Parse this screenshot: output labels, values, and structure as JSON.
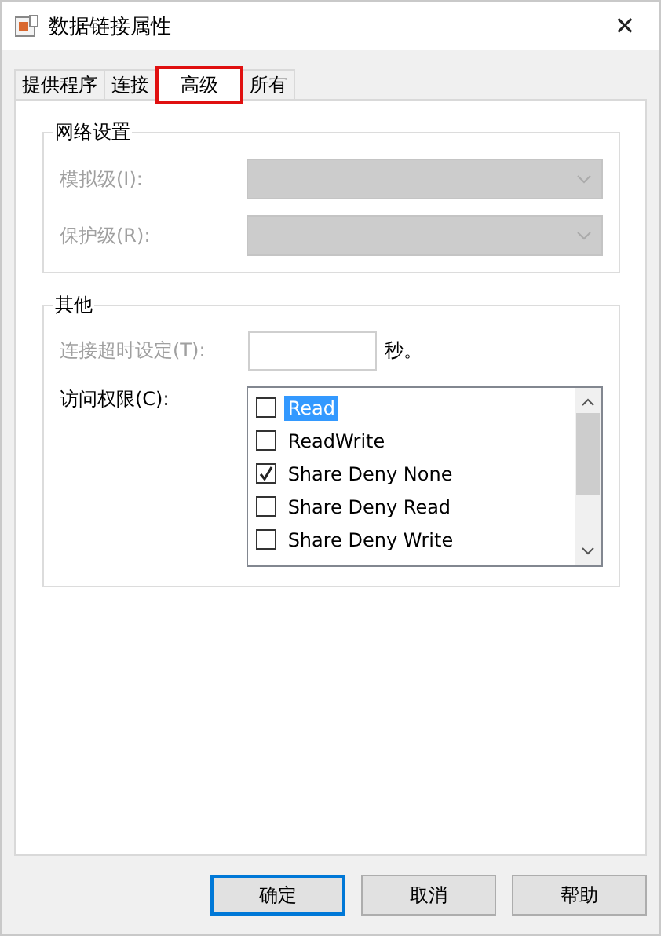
{
  "window": {
    "title": "数据链接属性",
    "close": "✕"
  },
  "tabs": [
    {
      "label": "提供程序",
      "selected": false
    },
    {
      "label": "连接",
      "selected": false
    },
    {
      "label": "高级",
      "selected": true
    },
    {
      "label": "所有",
      "selected": false
    }
  ],
  "network_group": {
    "title": "网络设置",
    "fields": [
      {
        "label": "模拟级(I):",
        "disabled": true
      },
      {
        "label": "保护级(R):",
        "disabled": true
      }
    ]
  },
  "other_group": {
    "title": "其他",
    "timeout": {
      "label": "连接超时设定(T):",
      "disabled": true,
      "unit": "秒。"
    },
    "access": {
      "label": "访问权限(C):",
      "items": [
        {
          "label": "Read",
          "checked": false,
          "selected": true
        },
        {
          "label": "ReadWrite",
          "checked": false,
          "selected": false
        },
        {
          "label": "Share Deny None",
          "checked": true,
          "selected": false
        },
        {
          "label": "Share Deny Read",
          "checked": false,
          "selected": false
        },
        {
          "label": "Share Deny Write",
          "checked": false,
          "selected": false
        }
      ]
    }
  },
  "buttons": [
    {
      "label": "确定",
      "default": true
    },
    {
      "label": "取消",
      "default": false
    },
    {
      "label": "帮助",
      "default": false
    }
  ]
}
